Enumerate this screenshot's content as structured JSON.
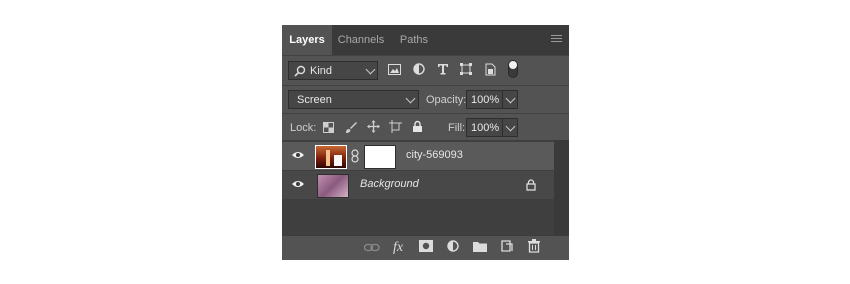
{
  "tabs": [
    "Layers",
    "Channels",
    "Paths"
  ],
  "filter": {
    "kind_label": "Kind",
    "icons": [
      "search-icon",
      "image-filter-icon",
      "adjustment-filter-icon",
      "type-filter-icon",
      "shape-filter-icon",
      "smart-object-filter-icon",
      "filter-toggle-icon"
    ]
  },
  "blend": {
    "mode": "Screen",
    "opacity_label": "Opacity:",
    "opacity_value": "100%"
  },
  "lock": {
    "label": "Lock:",
    "fill_label": "Fill:",
    "fill_value": "100%",
    "icons": [
      "lock-transparent-icon",
      "lock-image-icon",
      "lock-position-icon",
      "lock-artboard-icon",
      "lock-all-icon"
    ]
  },
  "layers": [
    {
      "name": "city-569093",
      "selected": true,
      "visible": true,
      "has_mask": true,
      "locked": false
    },
    {
      "name": "Background",
      "selected": false,
      "visible": true,
      "has_mask": false,
      "locked": true
    }
  ],
  "bottom_icons": [
    "link-icon",
    "fx-icon",
    "mask-icon",
    "adjustment-icon",
    "folder-icon",
    "new-layer-icon",
    "trash-icon"
  ],
  "colors": {
    "panel": "#535353",
    "tabbar": "#3a3a3a",
    "selected_row": "#5a5a5a"
  }
}
